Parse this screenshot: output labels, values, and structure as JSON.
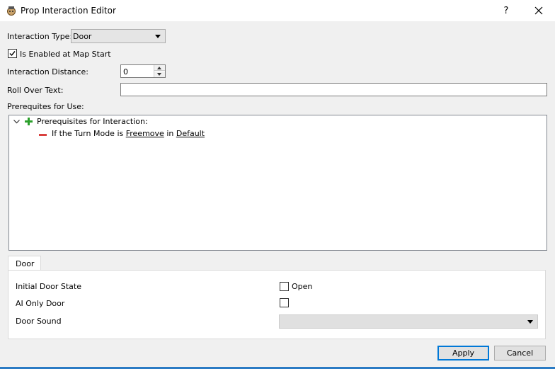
{
  "window": {
    "title": "Prop Interaction Editor",
    "help_label": "?"
  },
  "form": {
    "interaction_type_label": "Interaction Type:",
    "interaction_type_value": "Door",
    "enabled_label": "Is Enabled at Map Start",
    "enabled_checked": true,
    "distance_label": "Interaction Distance:",
    "distance_value": "0",
    "rollover_label": "Roll Over Text:",
    "rollover_value": "",
    "prereq_label": "Prerequites for Use:"
  },
  "tree": {
    "root_label": "Prerequisites for Interaction:",
    "condition": {
      "prefix": "If the Turn Mode is",
      "mode": "Freemove",
      "connector": "in",
      "target": "Default"
    }
  },
  "tabs": [
    {
      "label": "Door",
      "selected": true
    }
  ],
  "door": {
    "initial_state_label": "Initial Door State",
    "open_label": "Open",
    "open_checked": false,
    "ai_only_label": "AI Only Door",
    "ai_only_checked": false,
    "sound_label": "Door Sound",
    "sound_value": ""
  },
  "buttons": {
    "apply": "Apply",
    "cancel": "Cancel"
  },
  "colors": {
    "accent": "#0078d7",
    "add": "#2ca02c",
    "remove": "#d9413f"
  },
  "icons": [
    "app-icon",
    "help-icon",
    "close-icon",
    "chevron-down-icon",
    "add-icon",
    "remove-icon"
  ]
}
